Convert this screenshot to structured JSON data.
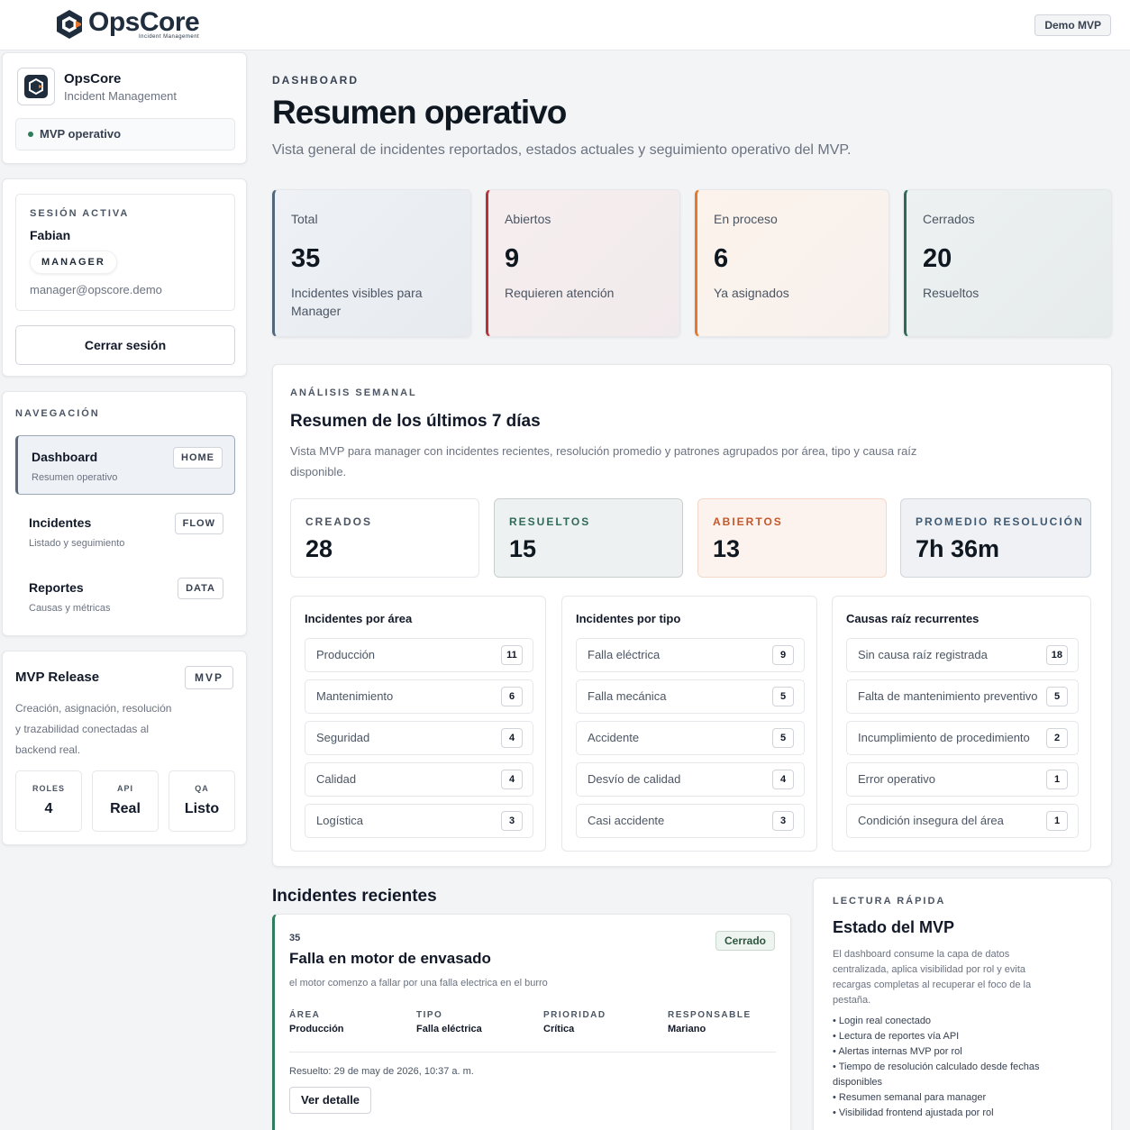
{
  "topbar": {
    "logo_name": "OpsCore",
    "logo_tagline": "Incident Management",
    "demo_badge": "Demo MVP"
  },
  "sidebar": {
    "brand": {
      "title": "OpsCore",
      "subtitle": "Incident Management",
      "status": "MVP operativo"
    },
    "session": {
      "label": "SESIÓN ACTIVA",
      "user": "Fabian",
      "role": "MANAGER",
      "email": "manager@opscore.demo",
      "logout_label": "Cerrar sesión"
    },
    "nav": {
      "label": "NAVEGACIÓN",
      "items": [
        {
          "title": "Dashboard",
          "subtitle": "Resumen operativo",
          "tag": "HOME"
        },
        {
          "title": "Incidentes",
          "subtitle": "Listado y seguimiento",
          "tag": "FLOW"
        },
        {
          "title": "Reportes",
          "subtitle": "Causas y métricas",
          "tag": "DATA"
        }
      ]
    },
    "release": {
      "title": "MVP Release",
      "tag": "MVP",
      "description": "Creación, asignación, resolución y trazabilidad conectadas al backend real.",
      "stats": [
        {
          "label": "ROLES",
          "value": "4"
        },
        {
          "label": "API",
          "value": "Real"
        },
        {
          "label": "QA",
          "value": "Listo"
        }
      ]
    }
  },
  "header": {
    "eyebrow": "DASHBOARD",
    "title": "Resumen operativo",
    "description": "Vista general de incidentes reportados, estados actuales y seguimiento operativo del MVP."
  },
  "kpis": [
    {
      "label": "Total",
      "value": "35",
      "description": "Incidentes visibles para Manager",
      "accent": "#52667d"
    },
    {
      "label": "Abiertos",
      "value": "9",
      "description": "Requieren atención",
      "accent": "#b8323a"
    },
    {
      "label": "En proceso",
      "value": "6",
      "description": "Ya asignados",
      "accent": "#e8772e"
    },
    {
      "label": "Cerrados",
      "value": "20",
      "description": "Resueltos",
      "accent": "#2e6b55"
    }
  ],
  "weekly": {
    "eyebrow": "ANÁLISIS SEMANAL",
    "title": "Resumen de los últimos 7 días",
    "description": "Vista MVP para manager con incidentes recientes, resolución promedio y patrones agrupados por área, tipo y causa raíz disponible.",
    "stats": [
      {
        "label": "CREADOS",
        "value": "28",
        "color": "#4b5563"
      },
      {
        "label": "RESUELTOS",
        "value": "15",
        "color": "#2e6b55"
      },
      {
        "label": "ABIERTOS",
        "value": "13",
        "color": "#c2582a"
      },
      {
        "label": "PROMEDIO RESOLUCIÓN",
        "value": "7h 36m",
        "color": "#3f5a73"
      }
    ],
    "by_area": {
      "title": "Incidentes por área",
      "rows": [
        {
          "label": "Producción",
          "count": "11"
        },
        {
          "label": "Mantenimiento",
          "count": "6"
        },
        {
          "label": "Seguridad",
          "count": "4"
        },
        {
          "label": "Calidad",
          "count": "4"
        },
        {
          "label": "Logística",
          "count": "3"
        }
      ]
    },
    "by_type": {
      "title": "Incidentes por tipo",
      "rows": [
        {
          "label": "Falla eléctrica",
          "count": "9"
        },
        {
          "label": "Falla mecánica",
          "count": "5"
        },
        {
          "label": "Accidente",
          "count": "5"
        },
        {
          "label": "Desvío de calidad",
          "count": "4"
        },
        {
          "label": "Casi accidente",
          "count": "3"
        }
      ]
    },
    "root_causes": {
      "title": "Causas raíz recurrentes",
      "rows": [
        {
          "label": "Sin causa raíz registrada",
          "count": "18"
        },
        {
          "label": "Falta de mantenimiento preventivo",
          "count": "5"
        },
        {
          "label": "Incumplimiento de procedimiento",
          "count": "2"
        },
        {
          "label": "Error operativo",
          "count": "1"
        },
        {
          "label": "Condición insegura del área",
          "count": "1"
        }
      ]
    }
  },
  "recent": {
    "title": "Incidentes recientes",
    "incident": {
      "id": "35",
      "status": "Cerrado",
      "title": "Falla en motor de envasado",
      "description": "el motor comenzo a fallar por una falla electrica en el burro",
      "fields": [
        {
          "label": "ÁREA",
          "value": "Producción"
        },
        {
          "label": "TIPO",
          "value": "Falla eléctrica"
        },
        {
          "label": "PRIORIDAD",
          "value": "Crítica"
        },
        {
          "label": "RESPONSABLE",
          "value": "Mariano"
        }
      ],
      "resolved": "Resuelto: 29 de may de 2026, 10:37 a. m.",
      "detail_label": "Ver detalle"
    }
  },
  "quick": {
    "eyebrow": "LECTURA RÁPIDA",
    "title": "Estado del MVP",
    "description": "El dashboard consume la capa de datos centralizada, aplica visibilidad por rol y evita recargas completas al recuperar el foco de la pestaña.",
    "items": [
      "Login real conectado",
      "Lectura de reportes vía API",
      "Alertas internas MVP por rol",
      "Tiempo de resolución calculado desde fechas disponibles",
      "Resumen semanal para manager",
      "Visibilidad frontend ajustada por rol"
    ]
  }
}
